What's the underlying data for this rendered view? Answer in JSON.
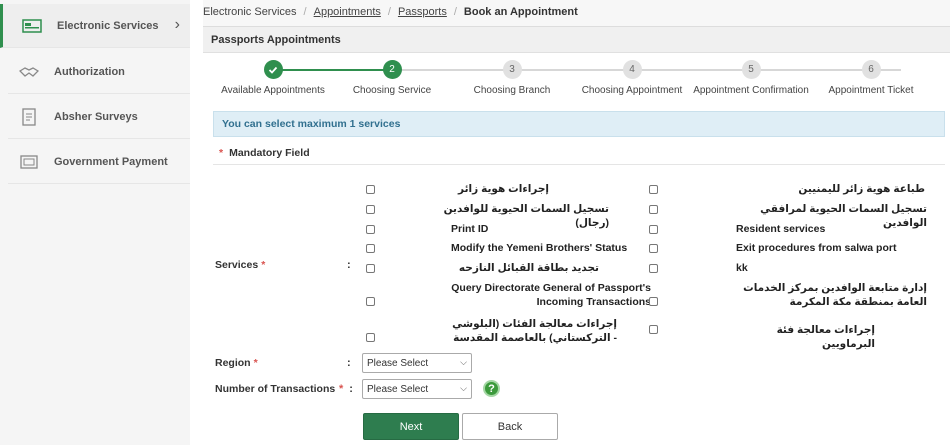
{
  "sidebar": {
    "items": [
      {
        "label": "Electronic Services",
        "icon": "services-icon"
      },
      {
        "label": "Authorization",
        "icon": "handshake-icon"
      },
      {
        "label": "Absher Surveys",
        "icon": "survey-icon"
      },
      {
        "label": "Government Payment",
        "icon": "payment-icon"
      }
    ]
  },
  "breadcrumb": {
    "items": [
      "Electronic Services",
      "Appointments",
      "Passports"
    ],
    "current": "Book an Appointment"
  },
  "panel": {
    "title": "Passports Appointments"
  },
  "steps": [
    {
      "number": "1",
      "label": "Available Appointments",
      "state": "done"
    },
    {
      "number": "2",
      "label": "Choosing Service",
      "state": "current"
    },
    {
      "number": "3",
      "label": "Choosing Branch",
      "state": "pending"
    },
    {
      "number": "4",
      "label": "Choosing Appointment",
      "state": "pending"
    },
    {
      "number": "5",
      "label": "Appointment Confirmation",
      "state": "pending"
    },
    {
      "number": "6",
      "label": "Appointment Ticket",
      "state": "pending"
    }
  ],
  "info": {
    "text": "You can select maximum 1 services"
  },
  "mandatory": {
    "star": "*",
    "text": "Mandatory Field"
  },
  "services": {
    "label": "Services",
    "required": "*",
    "colon": ":",
    "left": [
      "إجراءات هوية زائر",
      "تسجيل السمات الحيوية للوافدين (رجال)",
      "Print ID",
      "Modify the Yemeni Brothers' Status",
      "تجديد بطاقة القبائل النازحه",
      "Query Directorate General of Passport's Incoming Transactions",
      "إجراءات معالجة الفئات (البلوشي - التركستاني) بالعاصمة المقدسة"
    ],
    "right": [
      "طباعة هوية زائر لليمنيين",
      "تسجيل السمات الحيوية لمرافقي الوافدين",
      "Resident services",
      "Exit procedures from salwa port",
      "kk",
      "إدارة متابعة الوافدين بمركز الخدمات العامة بمنطقة مكة المكرمة",
      "إجراءات معالجة فئة البرماويين"
    ]
  },
  "region": {
    "label": "Region",
    "required": "*",
    "colon": ":",
    "value": "Please Select"
  },
  "transactions": {
    "label": "Number of Transactions",
    "required": "*",
    "colon": ":",
    "value": "Please Select"
  },
  "buttons": {
    "next": "Next",
    "back": "Back"
  },
  "colors": {
    "accent": "#2f8f4e",
    "info_bg": "#dfeef6",
    "info_text": "#31708f"
  }
}
